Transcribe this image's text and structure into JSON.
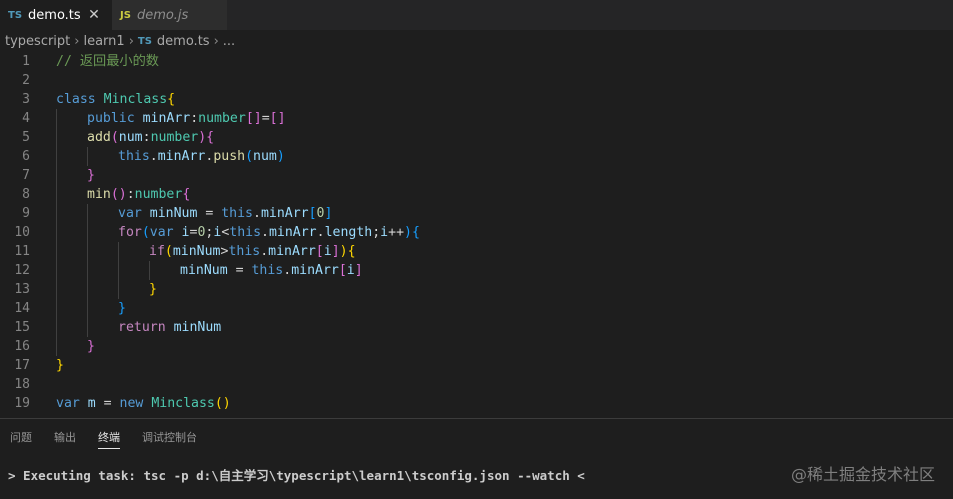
{
  "tabs": [
    {
      "lang": "TS",
      "name": "demo.ts",
      "close": "✕"
    },
    {
      "lang": "JS",
      "name": "demo.js"
    }
  ],
  "breadcrumb": {
    "items": [
      "typescript",
      "learn1"
    ],
    "file_lang": "TS",
    "file": "demo.ts",
    "more": "..."
  },
  "editor": {
    "lines": [
      {
        "n": "1",
        "indent": 0,
        "tokens": [
          [
            "t-comment",
            "// 返回最小的数"
          ]
        ]
      },
      {
        "n": "2",
        "indent": 0,
        "tokens": []
      },
      {
        "n": "3",
        "indent": 0,
        "tokens": [
          [
            "t-kw",
            "class "
          ],
          [
            "t-type",
            "Minclass"
          ],
          [
            "t-b1",
            "{"
          ]
        ]
      },
      {
        "n": "4",
        "indent": 1,
        "tokens": [
          [
            "t-kw",
            "public "
          ],
          [
            "t-var",
            "minArr"
          ],
          [
            "t-p",
            ":"
          ],
          [
            "t-type",
            "number"
          ],
          [
            "t-b2",
            "[]"
          ],
          [
            "t-p",
            "="
          ],
          [
            "t-b2",
            "[]"
          ]
        ]
      },
      {
        "n": "5",
        "indent": 1,
        "tokens": [
          [
            "t-fn",
            "add"
          ],
          [
            "t-b2",
            "("
          ],
          [
            "t-var",
            "num"
          ],
          [
            "t-p",
            ":"
          ],
          [
            "t-type",
            "number"
          ],
          [
            "t-b2",
            ")"
          ],
          [
            "t-b2",
            "{"
          ]
        ]
      },
      {
        "n": "6",
        "indent": 2,
        "tokens": [
          [
            "t-kw",
            "this"
          ],
          [
            "t-p",
            "."
          ],
          [
            "t-var",
            "minArr"
          ],
          [
            "t-p",
            "."
          ],
          [
            "t-fn",
            "push"
          ],
          [
            "t-b3",
            "("
          ],
          [
            "t-var",
            "num"
          ],
          [
            "t-b3",
            ")"
          ]
        ]
      },
      {
        "n": "7",
        "indent": 1,
        "tokens": [
          [
            "t-b2",
            "}"
          ]
        ]
      },
      {
        "n": "8",
        "indent": 1,
        "tokens": [
          [
            "t-fn",
            "min"
          ],
          [
            "t-b2",
            "()"
          ],
          [
            "t-p",
            ":"
          ],
          [
            "t-type",
            "number"
          ],
          [
            "t-b2",
            "{"
          ]
        ]
      },
      {
        "n": "9",
        "indent": 2,
        "tokens": [
          [
            "t-kw",
            "var "
          ],
          [
            "t-var",
            "minNum"
          ],
          [
            "t-p",
            " = "
          ],
          [
            "t-kw",
            "this"
          ],
          [
            "t-p",
            "."
          ],
          [
            "t-var",
            "minArr"
          ],
          [
            "t-b3",
            "["
          ],
          [
            "t-num",
            "0"
          ],
          [
            "t-b3",
            "]"
          ]
        ]
      },
      {
        "n": "10",
        "indent": 2,
        "tokens": [
          [
            "t-ctrl",
            "for"
          ],
          [
            "t-b3",
            "("
          ],
          [
            "t-kw",
            "var "
          ],
          [
            "t-var",
            "i"
          ],
          [
            "t-p",
            "="
          ],
          [
            "t-num",
            "0"
          ],
          [
            "t-p",
            ";"
          ],
          [
            "t-var",
            "i"
          ],
          [
            "t-p",
            "<"
          ],
          [
            "t-kw",
            "this"
          ],
          [
            "t-p",
            "."
          ],
          [
            "t-var",
            "minArr"
          ],
          [
            "t-p",
            "."
          ],
          [
            "t-var",
            "length"
          ],
          [
            "t-p",
            ";"
          ],
          [
            "t-var",
            "i"
          ],
          [
            "t-p",
            "++"
          ],
          [
            "t-b3",
            ")"
          ],
          [
            "t-b3",
            "{"
          ]
        ]
      },
      {
        "n": "11",
        "indent": 3,
        "tokens": [
          [
            "t-ctrl",
            "if"
          ],
          [
            "t-b1",
            "("
          ],
          [
            "t-var",
            "minNum"
          ],
          [
            "t-p",
            ">"
          ],
          [
            "t-kw",
            "this"
          ],
          [
            "t-p",
            "."
          ],
          [
            "t-var",
            "minArr"
          ],
          [
            "t-b2",
            "["
          ],
          [
            "t-var",
            "i"
          ],
          [
            "t-b2",
            "]"
          ],
          [
            "t-b1",
            ")"
          ],
          [
            "t-b1",
            "{"
          ]
        ]
      },
      {
        "n": "12",
        "indent": 4,
        "tokens": [
          [
            "t-var",
            "minNum"
          ],
          [
            "t-p",
            " = "
          ],
          [
            "t-kw",
            "this"
          ],
          [
            "t-p",
            "."
          ],
          [
            "t-var",
            "minArr"
          ],
          [
            "t-b2",
            "["
          ],
          [
            "t-var",
            "i"
          ],
          [
            "t-b2",
            "]"
          ]
        ]
      },
      {
        "n": "13",
        "indent": 3,
        "tokens": [
          [
            "t-b1",
            "}"
          ]
        ]
      },
      {
        "n": "14",
        "indent": 2,
        "tokens": [
          [
            "t-b3",
            "}"
          ]
        ]
      },
      {
        "n": "15",
        "indent": 2,
        "tokens": [
          [
            "t-ctrl",
            "return "
          ],
          [
            "t-var",
            "minNum"
          ]
        ]
      },
      {
        "n": "16",
        "indent": 1,
        "tokens": [
          [
            "t-b2",
            "}"
          ]
        ]
      },
      {
        "n": "17",
        "indent": 0,
        "tokens": [
          [
            "t-b1",
            "}"
          ]
        ]
      },
      {
        "n": "18",
        "indent": 0,
        "tokens": []
      },
      {
        "n": "19",
        "indent": 0,
        "tokens": [
          [
            "t-kw",
            "var "
          ],
          [
            "t-var",
            "m"
          ],
          [
            "t-p",
            " = "
          ],
          [
            "t-kw",
            "new "
          ],
          [
            "t-type",
            "Minclass"
          ],
          [
            "t-b1",
            "()"
          ]
        ]
      }
    ]
  },
  "panel": {
    "tabs": [
      "问题",
      "输出",
      "终端",
      "调试控制台"
    ],
    "active_tab": 2,
    "terminal_line": "> Executing task: tsc -p d:\\自主学习\\typescript\\learn1\\tsconfig.json --watch <"
  },
  "watermark": "@稀土掘金技术社区",
  "colors": {
    "editor_bg": "#1e1e1e",
    "tab_bar_bg": "#252526",
    "ts_icon": "#519aba",
    "js_icon": "#cbcb41"
  }
}
